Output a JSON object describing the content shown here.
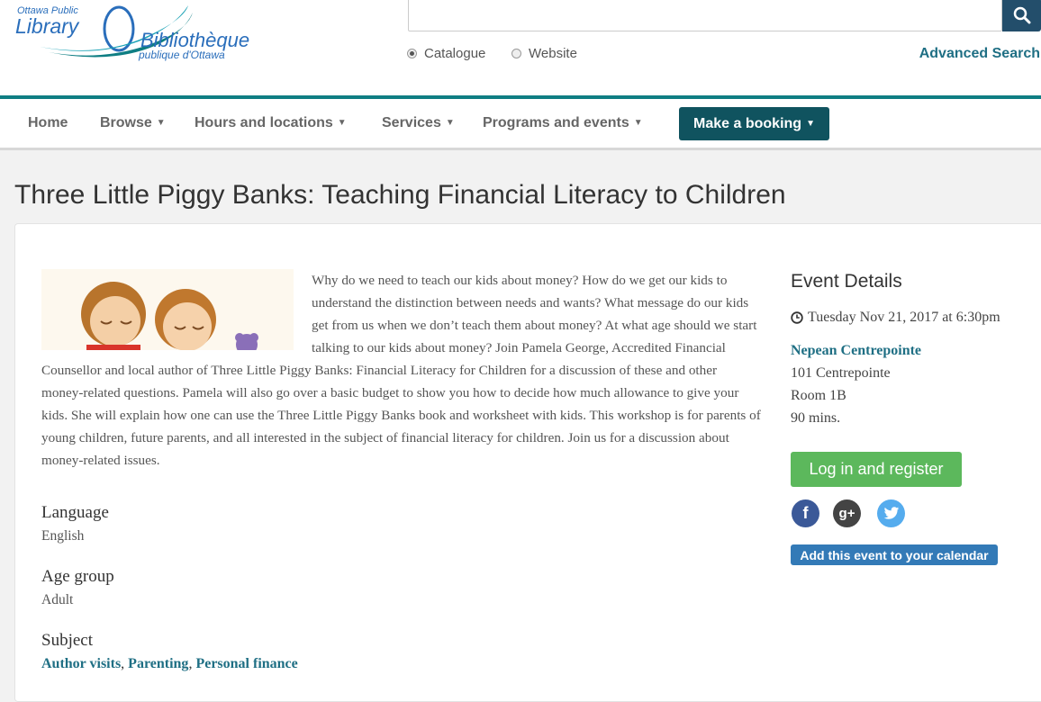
{
  "logo": {
    "line1": "Ottawa Public",
    "line2": "Library",
    "line3": "Bibliothèque",
    "line4": "publique d'Ottawa"
  },
  "search": {
    "value": "",
    "placeholder": "",
    "button_icon": "search-icon",
    "options": [
      {
        "label": "Catalogue",
        "selected": true
      },
      {
        "label": "Website",
        "selected": false
      }
    ],
    "advanced_label": "Advanced Search"
  },
  "nav": {
    "items": [
      {
        "label": "Home",
        "dropdown": false
      },
      {
        "label": "Browse",
        "dropdown": true
      },
      {
        "label": "Hours and locations",
        "dropdown": true
      },
      {
        "label": "Services",
        "dropdown": true
      },
      {
        "label": "Programs and events",
        "dropdown": true
      }
    ],
    "booking_label": "Make a booking"
  },
  "colors": {
    "brand_teal": "#0f7e83",
    "booking_bg": "#10535f",
    "link": "#1f6f84",
    "register_green": "#5cb85c",
    "calendar_blue": "#337ab7"
  },
  "page": {
    "title": "Three Little Piggy Banks: Teaching Financial Literacy to Children"
  },
  "event": {
    "description": "Why do we need to teach our kids about money?  How do we get our kids to understand the distinction between needs and wants?  What message do our kids get from us when we don’t teach them about money? At what age should we start talking to our kids about money?  Join Pamela George, Accredited Financial Counsellor and local author of Three Little Piggy Banks: Financial Literacy for Children for a discussion of these and other money-related questions.  Pamela will also go over a basic budget to show you how to decide how much allowance to give your kids.  She will explain how one can use the Three Little Piggy Banks book and worksheet with kids.  This workshop is for parents of young children, future parents, and all interested in the subject of financial literacy for children.   Join us for a discussion about money-related issues.",
    "fields": [
      {
        "heading": "Language",
        "value": "English"
      },
      {
        "heading": "Age group",
        "value": "Adult"
      },
      {
        "heading": "Subject",
        "links": [
          "Author visits",
          "Parenting",
          "Personal finance"
        ]
      }
    ]
  },
  "details": {
    "heading": "Event Details",
    "date": "Tuesday Nov 21, 2017 at 6:30pm",
    "location": "Nepean Centrepointe",
    "address": "101 Centrepointe",
    "room": "Room 1B",
    "duration": "90 mins.",
    "register_label": "Log in and register",
    "social": [
      {
        "name": "facebook-icon",
        "glyph": "f",
        "color": "#3b5998"
      },
      {
        "name": "google-plus-icon",
        "glyph": "g+",
        "color": "#444444"
      },
      {
        "name": "twitter-icon",
        "glyph": "t",
        "color": "#55acee"
      }
    ],
    "calendar_label": "Add this event to your calendar"
  }
}
